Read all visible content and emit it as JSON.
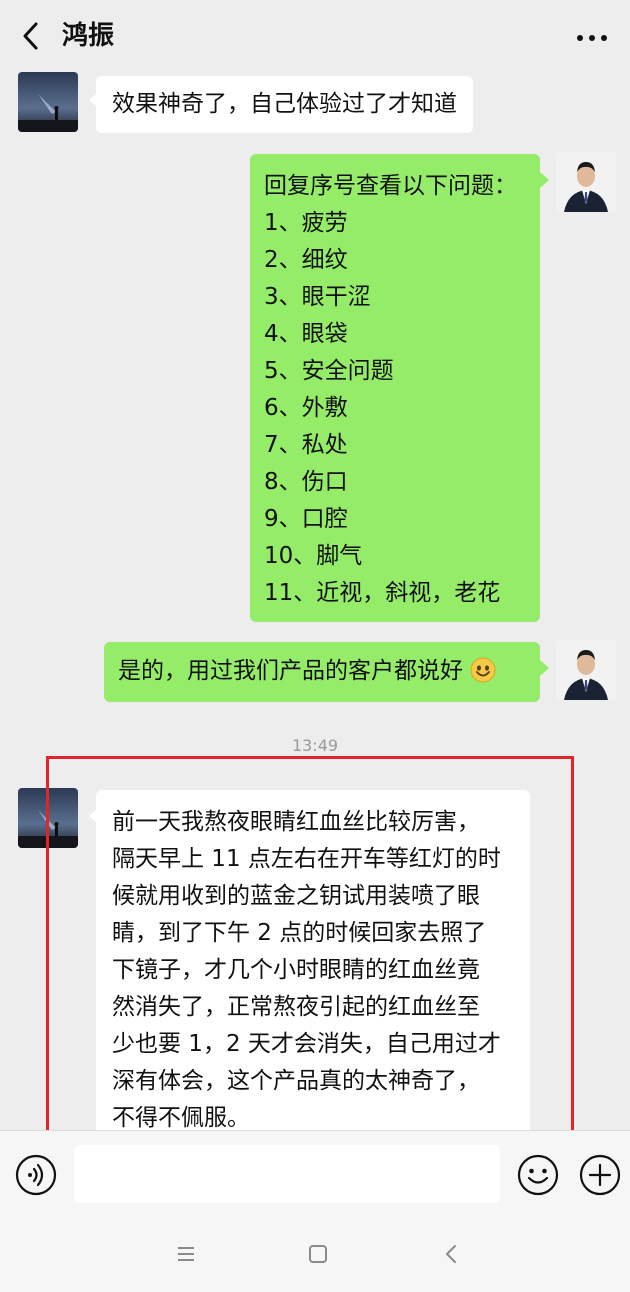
{
  "header": {
    "back_icon": "chevron-left-icon",
    "title": "鸿振",
    "more_icon": "more-dots-icon"
  },
  "messages": [
    {
      "side": "left",
      "avatar": "night-sky-avatar",
      "text": "效果神奇了，自己体验过了才知道"
    },
    {
      "side": "right",
      "avatar": "man-in-suit-avatar",
      "intro": "回复序号查看以下问题：",
      "items": [
        "1、疲劳",
        "2、细纹",
        "3、眼干涩",
        "4、眼袋",
        "5、安全问题",
        "6、外敷",
        "7、私处",
        "8、伤口",
        "9、口腔",
        "10、脚气",
        "11、近视，斜视，老花"
      ]
    },
    {
      "side": "right",
      "avatar": "man-in-suit-avatar",
      "text": "是的，用过我们产品的客户都说好",
      "emoji": "smile-emoji"
    },
    {
      "side": "left",
      "avatar": "night-sky-avatar",
      "lines": [
        "前一天我熬夜眼睛红血丝比较厉害，",
        "隔天早上 11 点左右在开车等红灯的时",
        "候就用收到的蓝金之钥试用装喷了眼",
        "睛，到了下午 2 点的时候回家去照了",
        "下镜子，才几个小时眼睛的红血丝竟",
        "然消失了，正常熬夜引起的红血丝至",
        "少也要 1，2 天才会消失，自己用过才",
        "深有体会，这个产品真的太神奇了，",
        "不得不佩服。"
      ]
    }
  ],
  "timestamp": "13:49",
  "colors": {
    "background": "#ededed",
    "bubble_green": "#95ec69",
    "bubble_white": "#ffffff",
    "highlight": "#e0262b"
  },
  "input_bar": {
    "voice_icon": "voice-icon",
    "emoji_icon": "emoji-icon",
    "plus_icon": "plus-icon"
  },
  "nav_bar": {
    "menu_icon": "menu-icon",
    "home_icon": "home-square-icon",
    "back_icon": "back-arrow-icon"
  }
}
